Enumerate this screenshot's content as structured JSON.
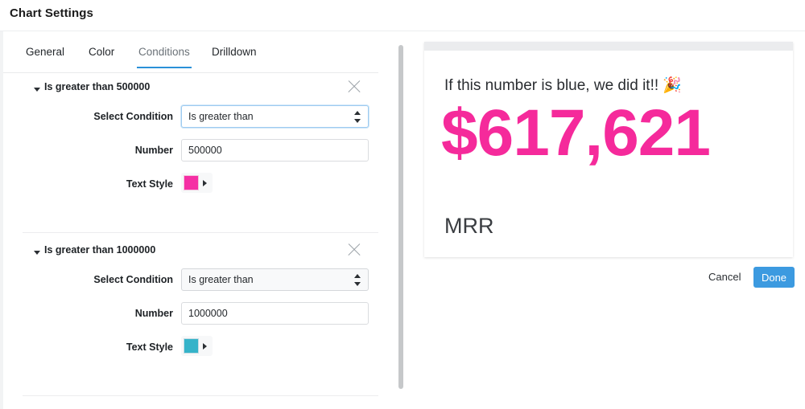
{
  "header": {
    "title": "Chart Settings"
  },
  "tabs": [
    {
      "label": "General",
      "active": false
    },
    {
      "label": "Color",
      "active": false
    },
    {
      "label": "Conditions",
      "active": true
    },
    {
      "label": "Drilldown",
      "active": false
    }
  ],
  "conditions": [
    {
      "title": "Is greater than 500000",
      "condition_label": "Select Condition",
      "condition_value": "Is greater than",
      "number_label": "Number",
      "number_value": "500000",
      "text_style_label": "Text Style",
      "swatch_color": "#f52fa4",
      "focused": true
    },
    {
      "title": "Is greater than 1000000",
      "condition_label": "Select Condition",
      "condition_value": "Is greater than",
      "number_label": "Number",
      "number_value": "1000000",
      "text_style_label": "Text Style",
      "swatch_color": "#35b3c9",
      "focused": false
    }
  ],
  "preview": {
    "title": "If this number is blue, we did it!! 🎉",
    "value": "$617,621",
    "value_color": "#f52a9b",
    "label": "MRR"
  },
  "footer": {
    "cancel_label": "Cancel",
    "done_label": "Done",
    "done_color": "#3c9ae0"
  }
}
